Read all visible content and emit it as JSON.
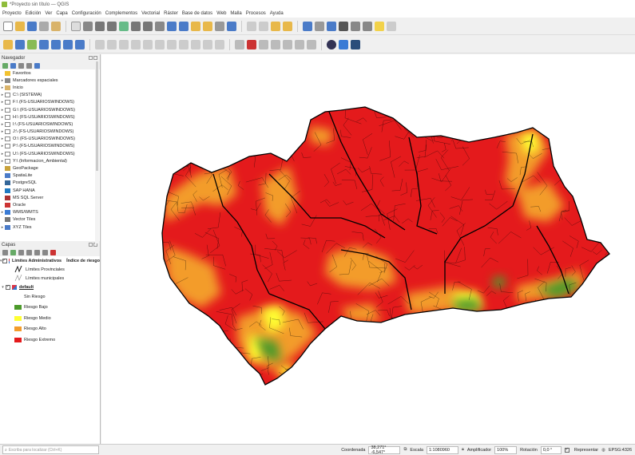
{
  "window": {
    "title": "*Proyecto sin título — QGIS"
  },
  "menu": [
    "Proyecto",
    "Edición",
    "Ver",
    "Capa",
    "Configuración",
    "Complementos",
    "Vectorial",
    "Ráster",
    "Base de datos",
    "Web",
    "Malla",
    "Procesos",
    "Ayuda"
  ],
  "browser": {
    "title": "Navegador",
    "items": [
      {
        "label": "Favoritos",
        "icon": "star-icon",
        "arrow": ""
      },
      {
        "label": "Marcadores espaciales",
        "icon": "bookmark-icon",
        "arrow": "▸"
      },
      {
        "label": "Inicio",
        "icon": "home-folder-icon",
        "arrow": "▸"
      },
      {
        "label": "C:\\ (SISTEMA)",
        "icon": "drive-icon",
        "arrow": "▸"
      },
      {
        "label": "F:\\ (FS-USUARIOSWINDOWS)",
        "icon": "drive-icon",
        "arrow": "▸"
      },
      {
        "label": "G:\\ (FS-USUARIOSWINDOWS)",
        "icon": "drive-icon",
        "arrow": "▸"
      },
      {
        "label": "H:\\ (FS-USUARIOSWINDOWS)",
        "icon": "drive-icon",
        "arrow": "▸"
      },
      {
        "label": "I:\\ (FS-USUARIOSWINDOWS)",
        "icon": "drive-icon",
        "arrow": "▸"
      },
      {
        "label": "J:\\ (FS-USUARIOSWINDOWS)",
        "icon": "drive-icon",
        "arrow": "▸"
      },
      {
        "label": "O:\\ (FS-USUARIOSWINDOWS)",
        "icon": "drive-icon",
        "arrow": "▸"
      },
      {
        "label": "P:\\ (FS-USUARIOSWINDOWS)",
        "icon": "drive-icon",
        "arrow": "▸"
      },
      {
        "label": "U:\\ (FS-USUARIOSWINDOWS)",
        "icon": "drive-icon",
        "arrow": "▸"
      },
      {
        "label": "Y:\\ (Informacion_Ambiental)",
        "icon": "drive-icon",
        "arrow": "▸"
      },
      {
        "label": "GeoPackage",
        "icon": "geopackage-icon",
        "arrow": ""
      },
      {
        "label": "SpatiaLite",
        "icon": "spatialite-icon",
        "arrow": ""
      },
      {
        "label": "PostgreSQL",
        "icon": "postgresql-icon",
        "arrow": ""
      },
      {
        "label": "SAP HANA",
        "icon": "saphana-icon",
        "arrow": ""
      },
      {
        "label": "MS SQL Server",
        "icon": "mssql-icon",
        "arrow": ""
      },
      {
        "label": "Oracle",
        "icon": "oracle-icon",
        "arrow": ""
      },
      {
        "label": "WMS/WMTS",
        "icon": "wms-icon",
        "arrow": "▸"
      },
      {
        "label": "Vector Tiles",
        "icon": "vector-tiles-icon",
        "arrow": ""
      },
      {
        "label": "XYZ Tiles",
        "icon": "xyz-tiles-icon",
        "arrow": "▸"
      }
    ]
  },
  "layers": {
    "title": "Capas",
    "group1": {
      "label": "Límites Administrativos",
      "extra": "Índice de riesgo",
      "children": [
        "Límites Provinciales",
        "Límites municipales"
      ]
    },
    "group2": {
      "label": "default",
      "classes": [
        {
          "label": "Sin Riesgo",
          "color": ""
        },
        {
          "label": "Riesgo Bajo",
          "color": "#4c9a2a"
        },
        {
          "label": "Riesgo Medio",
          "color": "#ffff33"
        },
        {
          "label": "Riesgo Alto",
          "color": "#f39c2b"
        },
        {
          "label": "Riesgo Extremo",
          "color": "#e41a1c"
        }
      ]
    }
  },
  "status": {
    "search_placeholder": "Escriba para localizar (Ctrl+K)",
    "coord_label": "Coordenada",
    "coord_value": "38,271° -6,547°",
    "scale_label": "Escala",
    "scale_value": "1:1080960",
    "magnifier_label": "Amplificador",
    "magnifier_value": "100%",
    "rotation_label": "Rotación",
    "rotation_value": "0,0 °",
    "render_label": "Representar",
    "crs_label": "EPSG:4326"
  },
  "colors": {
    "extreme": "#e41a1c",
    "high": "#f39c2b",
    "medium": "#ffff33",
    "low": "#4c9a2a"
  }
}
